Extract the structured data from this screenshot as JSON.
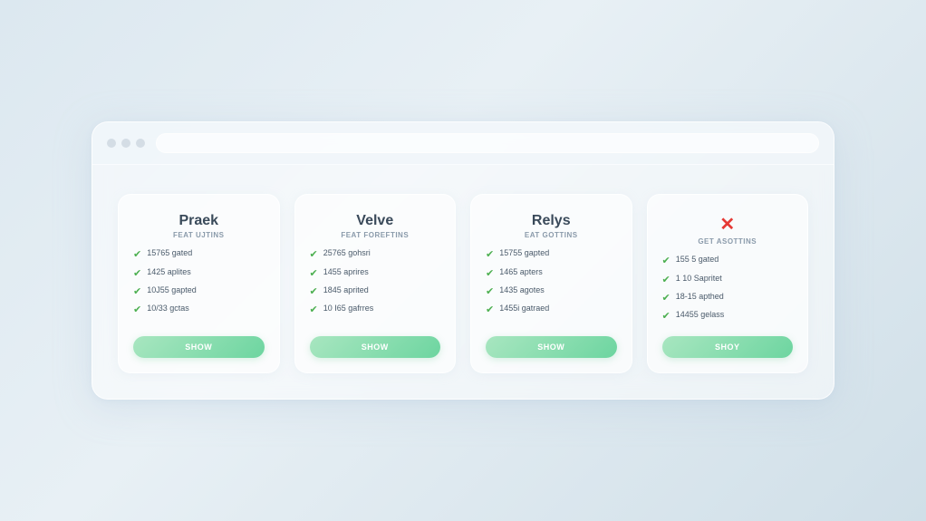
{
  "browser": {
    "traffic_lights": [
      "close",
      "minimize",
      "maximize"
    ]
  },
  "plans": [
    {
      "id": "praek",
      "name": "Praek",
      "subtitle": "FEAT UJTINS",
      "has_x": false,
      "features": [
        "15765 gated",
        "1425 aplites",
        "10J55 gapted",
        "10/33 gctas"
      ],
      "button_label": "SHOW"
    },
    {
      "id": "velve",
      "name": "Velve",
      "subtitle": "FEAT FOREFTINS",
      "has_x": false,
      "features": [
        "25765 gohsri",
        "1455 aprires",
        "1845 aprited",
        "10 I65 gafrres"
      ],
      "button_label": "SHOW"
    },
    {
      "id": "relys",
      "name": "Relys",
      "subtitle": "EAT GOTTINS",
      "has_x": false,
      "features": [
        "15755 gapted",
        "1465 apters",
        "1435 agotes",
        "1455i gatraed"
      ],
      "button_label": "SHOW"
    },
    {
      "id": "fourth",
      "name": "",
      "subtitle": "GET ASOTTINS",
      "has_x": true,
      "features": [
        "155 5 gated",
        "1 10 Sapritet",
        "18-15 apthed",
        "14455 gelass"
      ],
      "button_label": "SHOY"
    }
  ]
}
